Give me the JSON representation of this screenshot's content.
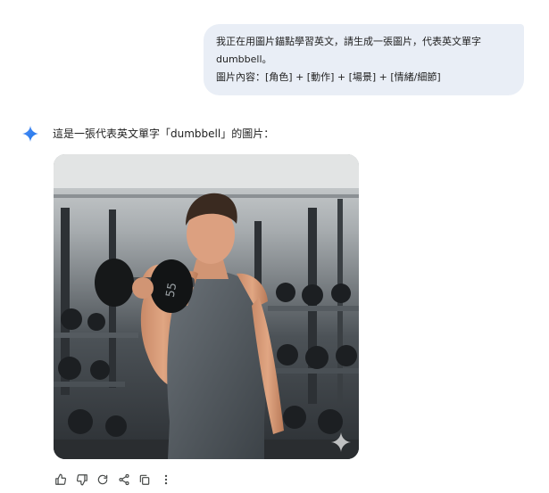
{
  "user_message": {
    "line1": "我正在用圖片錨點學習英文，請生成一張圖片，代表英文單字",
    "line2": "dumbbell。",
    "line3": "圖片內容：[角色] + [動作] + [場景] + [情緒/細節]"
  },
  "response": {
    "icon": "gemini-sparkle-icon",
    "text": "這是一張代表英文單字「dumbbell」的圖片：",
    "dumbbell_weight": "55"
  },
  "actions": [
    {
      "name": "thumbs-up-icon"
    },
    {
      "name": "thumbs-down-icon"
    },
    {
      "name": "regenerate-icon"
    },
    {
      "name": "share-icon"
    },
    {
      "name": "copy-icon"
    },
    {
      "name": "more-vert-icon"
    }
  ],
  "colors": {
    "bubble": "#e9eef6",
    "sparkle": "#4285f4",
    "icon": "#444746"
  }
}
